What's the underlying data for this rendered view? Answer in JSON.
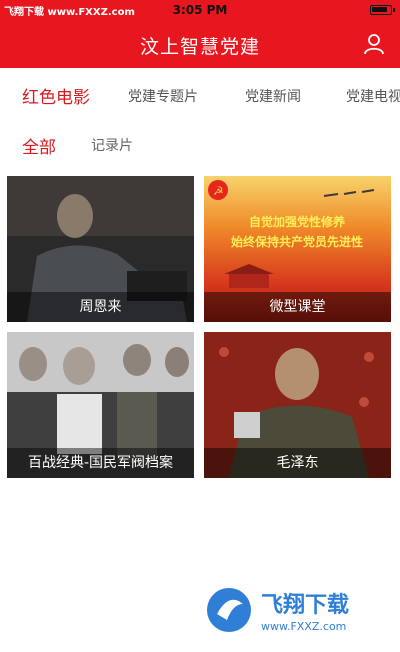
{
  "status_bar": {
    "watermark": "飞翔下载 www.FXXZ.com",
    "time": "3:05 PM"
  },
  "app_bar": {
    "title": "汶上智慧党建"
  },
  "tabs": [
    {
      "label": "红色电影",
      "active": true
    },
    {
      "label": "党建专题片",
      "active": false
    },
    {
      "label": "党建新闻",
      "active": false
    },
    {
      "label": "党建电视",
      "active": false
    }
  ],
  "subtabs": [
    {
      "label": "全部",
      "active": true
    },
    {
      "label": "记录片",
      "active": false
    }
  ],
  "cards": [
    {
      "caption": "周恩来"
    },
    {
      "caption": "微型课堂",
      "banner_line1": "自觉加强党性修养",
      "banner_line2": "始终保持共产党员先进性"
    },
    {
      "caption": "百战经典-国民军阀档案"
    },
    {
      "caption": "毛泽东"
    }
  ],
  "footer_watermark": {
    "brand": "飞翔下载",
    "url": "www.FXXZ.com"
  },
  "colors": {
    "primary_red": "#e8161e",
    "active_tab_red": "#d9191f",
    "watermark_blue": "#2f7fd6"
  }
}
